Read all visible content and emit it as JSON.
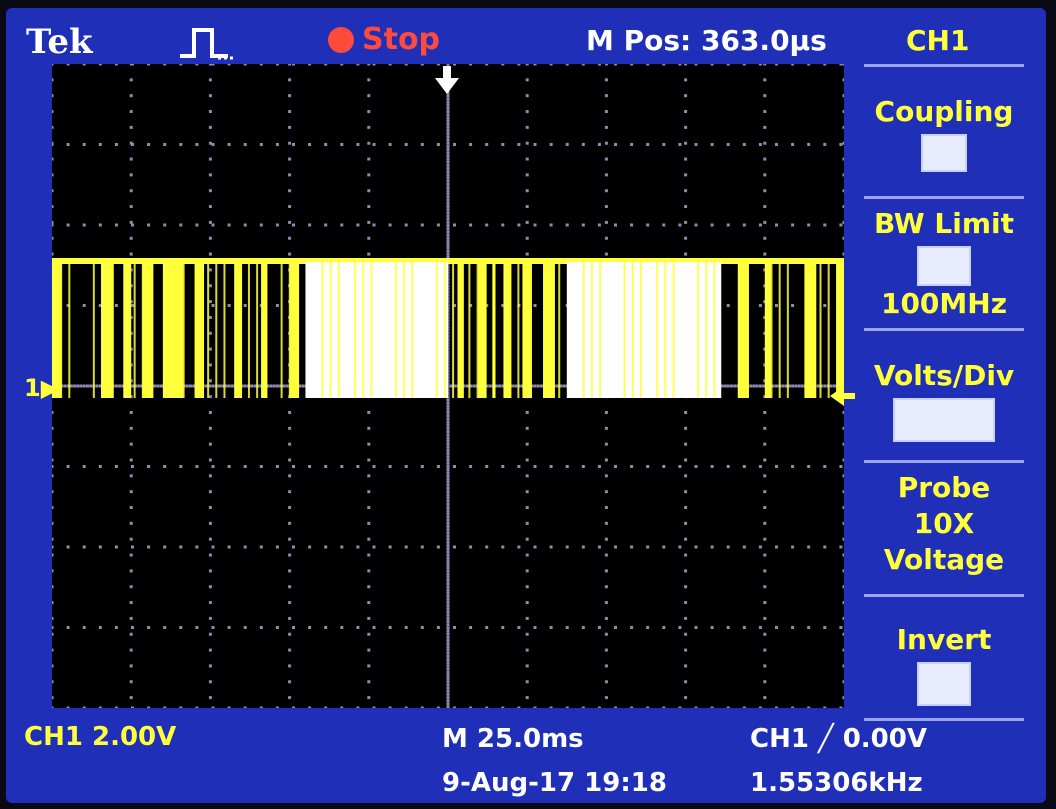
{
  "header": {
    "brand": "Tek",
    "run_state": "Stop",
    "m_pos": "M Pos: 363.0µs",
    "channel": "CH1"
  },
  "menu": {
    "items": [
      {
        "label": "Coupling",
        "value": ""
      },
      {
        "label": "BW Limit",
        "value": "",
        "sub": "100MHz"
      },
      {
        "label": "Volts/Div",
        "value": ""
      },
      {
        "label": "Probe",
        "value": "10X",
        "sub": "Voltage"
      },
      {
        "label": "Invert",
        "value": ""
      }
    ]
  },
  "footer": {
    "ch1_scale": "CH1  2.00V",
    "timebase": "M 25.0ms",
    "date": "9-Aug-17 19:18",
    "trigger": "CH1 ╱ 0.00V",
    "frequency": "1.55306kHz"
  },
  "markers": {
    "ch1": "1"
  },
  "colors": {
    "screen_bg": "#1f2fb8",
    "trace": "#ffff3c",
    "text_yellow": "#ffff3c",
    "stop_red": "#ff4a3c"
  },
  "trace_segments": [
    {
      "start": 0.0,
      "end": 0.012,
      "level": "high"
    },
    {
      "start": 0.062,
      "end": 0.078,
      "level": "high"
    },
    {
      "start": 0.09,
      "end": 0.1,
      "level": "high"
    },
    {
      "start": 0.114,
      "end": 0.128,
      "level": "high"
    },
    {
      "start": 0.14,
      "end": 0.166,
      "level": "high"
    },
    {
      "start": 0.18,
      "end": 0.192,
      "level": "high"
    },
    {
      "start": 0.23,
      "end": 0.24,
      "level": "high"
    },
    {
      "start": 0.264,
      "end": 0.272,
      "level": "high"
    },
    {
      "start": 0.3,
      "end": 0.312,
      "level": "high"
    },
    {
      "start": 0.32,
      "end": 0.5,
      "level": "fill"
    },
    {
      "start": 0.512,
      "end": 0.52,
      "level": "high"
    },
    {
      "start": 0.538,
      "end": 0.548,
      "level": "high"
    },
    {
      "start": 0.556,
      "end": 0.56,
      "level": "high"
    },
    {
      "start": 0.57,
      "end": 0.58,
      "level": "high"
    },
    {
      "start": 0.594,
      "end": 0.606,
      "level": "high"
    },
    {
      "start": 0.62,
      "end": 0.635,
      "level": "high"
    },
    {
      "start": 0.65,
      "end": 0.845,
      "level": "fill"
    },
    {
      "start": 0.866,
      "end": 0.88,
      "level": "high"
    },
    {
      "start": 0.9,
      "end": 0.908,
      "level": "high"
    },
    {
      "start": 0.95,
      "end": 0.965,
      "level": "high"
    },
    {
      "start": 0.99,
      "end": 1.0,
      "level": "high"
    }
  ]
}
